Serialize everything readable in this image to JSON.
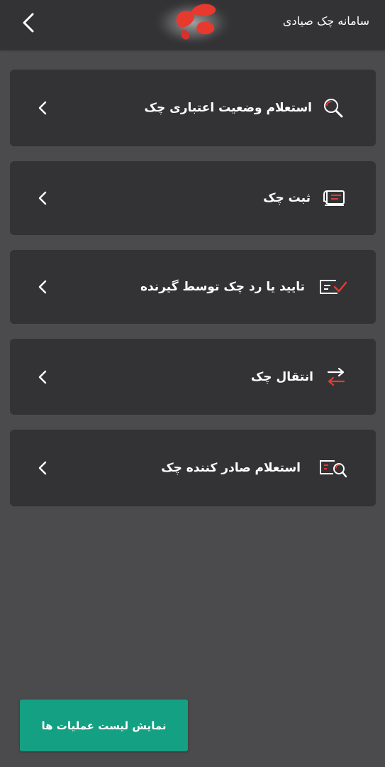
{
  "header": {
    "title": "سامانه چک صیادی",
    "back_icon": "chevron-left-icon",
    "logo_icon": "red-leaf-logo"
  },
  "menu": {
    "items": [
      {
        "label": "استعلام وضعیت اعتباری چک",
        "icon": "search-icon",
        "chevron": "chevron-left-icon"
      },
      {
        "label": "ثبت چک",
        "icon": "scroll-check-icon",
        "chevron": "chevron-left-icon"
      },
      {
        "label": "تایید یا رد چک توسط گیرنده",
        "icon": "check-approve-icon",
        "chevron": "chevron-left-icon"
      },
      {
        "label": "انتقال چک",
        "icon": "transfer-arrows-icon",
        "chevron": "chevron-left-icon"
      },
      {
        "label": "استعلام صادر کننده چک",
        "icon": "check-search-icon",
        "chevron": "chevron-left-icon"
      }
    ]
  },
  "footer": {
    "button_label": "نمایش لیست عملیات ها"
  },
  "colors": {
    "background": "#4b4b4d",
    "card": "#333335",
    "accent_red": "#e8392f",
    "button_green": "#14a083",
    "text": "#ffffff"
  }
}
